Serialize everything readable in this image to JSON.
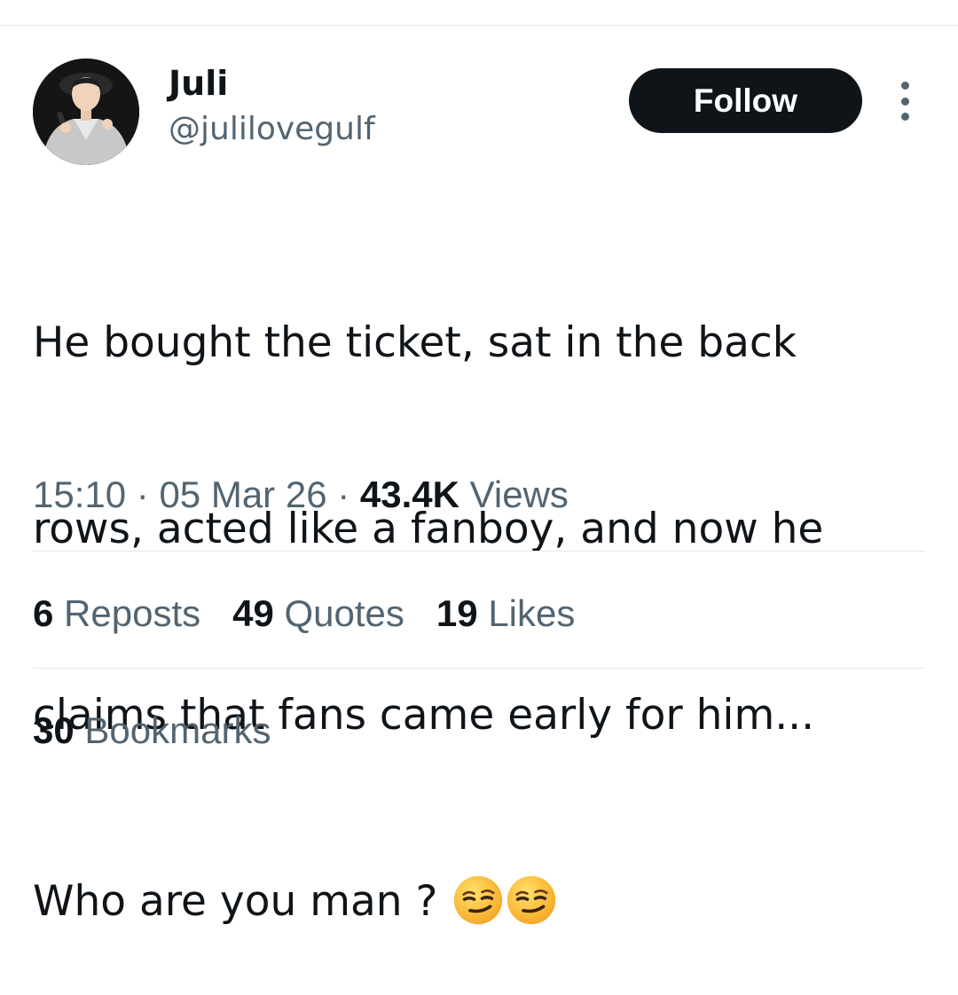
{
  "author": {
    "display_name": "Juli",
    "handle": "@julilovegulf"
  },
  "follow_button": {
    "label": "Follow"
  },
  "more_button": {
    "icon": "more-vertical-icon"
  },
  "tweet": {
    "lines": [
      "He bought the ticket, sat in the back",
      "rows, acted like a fanboy, and now he",
      "claims that fans came early for him...",
      "Who are you man ?"
    ],
    "emojis": [
      "smirking-face-emoji",
      "smirking-face-emoji"
    ]
  },
  "meta": {
    "time": "15:10",
    "separator": "·",
    "date": "05 Mar 26",
    "views_count": "43.4K",
    "views_label": "Views"
  },
  "stats": {
    "reposts": {
      "count": "6",
      "label": "Reposts"
    },
    "quotes": {
      "count": "49",
      "label": "Quotes"
    },
    "likes": {
      "count": "19",
      "label": "Likes"
    },
    "bookmarks": {
      "count": "30",
      "label": "Bookmarks"
    }
  },
  "colors": {
    "text_primary": "#0f1419",
    "text_secondary": "#536471",
    "divider": "#e7e9ea",
    "button_bg": "#0f1419",
    "button_text": "#ffffff"
  }
}
